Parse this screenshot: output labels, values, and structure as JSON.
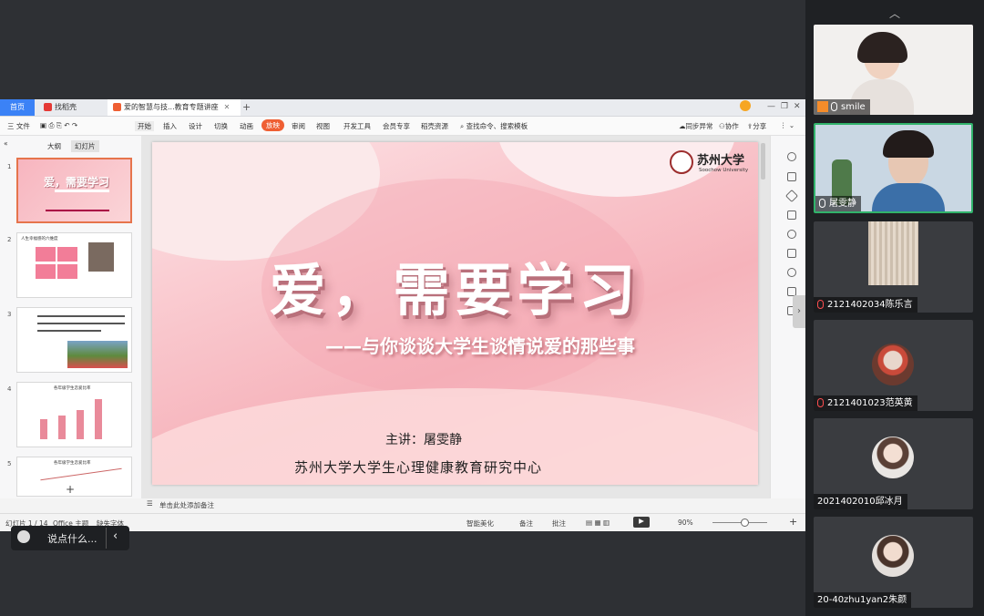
{
  "wps": {
    "tabs": [
      "首页",
      "找稻壳",
      "爱的智慧与技...教育专题讲座"
    ],
    "menu": [
      "三 文件",
      "开始",
      "插入",
      "设计",
      "切换",
      "动画",
      "放映",
      "审阅",
      "视图",
      "开发工具",
      "会员专享",
      "稻壳资源",
      "查找命令、搜索模板",
      "同步异常",
      "协作",
      "分享"
    ],
    "active_menu": "放映",
    "left_tabs": [
      "大纲",
      "幻灯片"
    ],
    "notes_placeholder": "单击此处添加备注",
    "status": {
      "slide_counter": "幻灯片 1 / 14",
      "theme": "Office 主题",
      "missing_font": "缺失字体",
      "smart_beautify": "智能美化",
      "notes": "备注",
      "comments": "批注",
      "zoom": "90%"
    }
  },
  "slide": {
    "university_cn": "苏州大学",
    "university_en": "Soochow University",
    "title": "爱，需要学习",
    "subtitle": "——与你谈谈大学生谈情说爱的那些事",
    "presenter": "主讲：屠雯静",
    "center": "苏州大学大学生心理健康教育研究中心"
  },
  "thumbnails": [
    {
      "num": "1",
      "title": "爱，需要学习"
    },
    {
      "num": "2",
      "title": "人生幸福感的六维度"
    },
    {
      "num": "3",
      "title": ""
    },
    {
      "num": "4",
      "title": "各年级学生恋爱比率"
    },
    {
      "num": "5",
      "title": "各年级学生恋爱比率"
    }
  ],
  "chat": {
    "placeholder": "说点什么..."
  },
  "participants": [
    {
      "name": "smile",
      "muted": false
    },
    {
      "name": "屠雯静",
      "muted": false
    },
    {
      "name": "2121402034陈乐言",
      "muted": true
    },
    {
      "name": "2121401023范英黄",
      "muted": true
    },
    {
      "name": "2021402010邱冰月",
      "muted": false
    },
    {
      "name": "20-40zhu1yan2朱颜",
      "muted": false
    }
  ],
  "colors": {
    "accent": "#ef5f33",
    "active_speaker": "#31b36b",
    "slide_pink": "#f6b3bb"
  }
}
